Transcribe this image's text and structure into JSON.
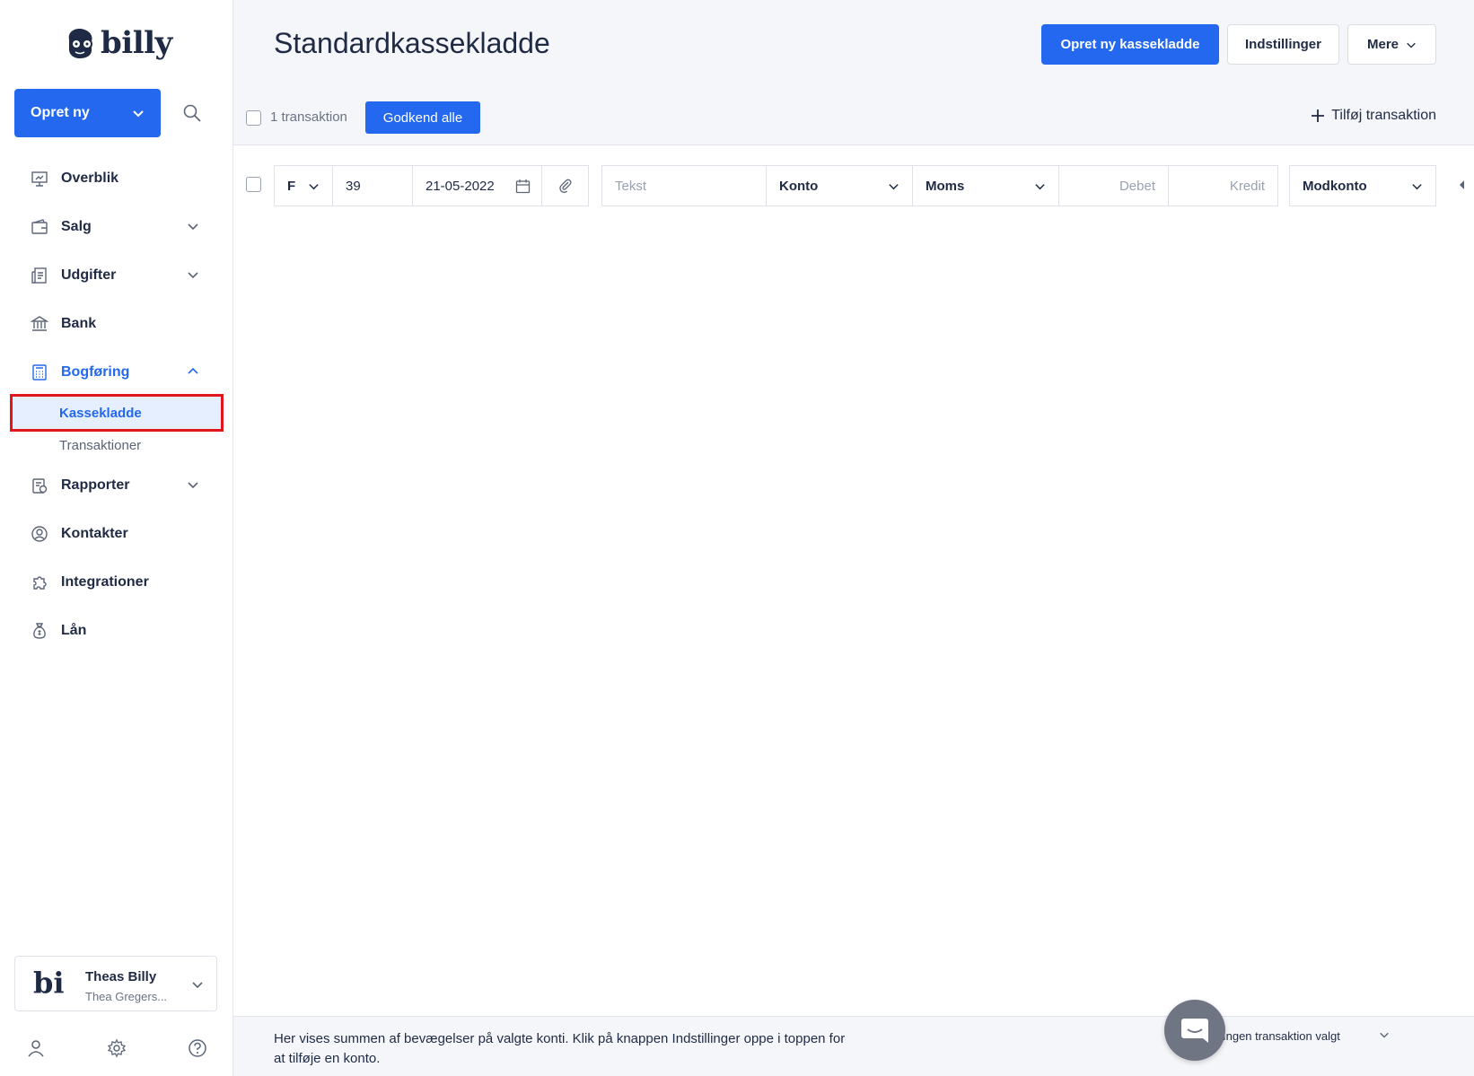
{
  "brand": {
    "name": "billy"
  },
  "sidebar": {
    "create_button": "Opret ny",
    "items": [
      {
        "label": "Overblik",
        "icon": "presentation-icon",
        "chevron": false
      },
      {
        "label": "Salg",
        "icon": "wallet-icon",
        "chevron": true
      },
      {
        "label": "Udgifter",
        "icon": "receipt-icon",
        "chevron": true
      },
      {
        "label": "Bank",
        "icon": "bank-icon",
        "chevron": false
      },
      {
        "label": "Bogføring",
        "icon": "calculator-icon",
        "chevron": true,
        "expanded": true
      },
      {
        "label": "Rapporter",
        "icon": "report-icon",
        "chevron": true
      },
      {
        "label": "Kontakter",
        "icon": "contact-icon",
        "chevron": false
      },
      {
        "label": "Integrationer",
        "icon": "puzzle-icon",
        "chevron": false
      },
      {
        "label": "Lån",
        "icon": "moneybag-icon",
        "chevron": false
      }
    ],
    "sub_items": [
      {
        "label": "Kassekladde",
        "selected": true
      },
      {
        "label": "Transaktioner",
        "selected": false
      }
    ],
    "org": {
      "logo_text": "billy",
      "name": "Theas Billy",
      "subtitle": "Thea Gregers..."
    }
  },
  "header": {
    "title": "Standardkassekladde",
    "primary_button": "Opret ny kassekladde",
    "settings_button": "Indstillinger",
    "more_button": "Mere"
  },
  "toolbar": {
    "transaction_count": "1 transaktion",
    "approve_all": "Godkend alle",
    "add_transaction": "Tilføj transaktion"
  },
  "row": {
    "type": "F",
    "number": "39",
    "date": "21-05-2022",
    "text_placeholder": "Tekst",
    "account": "Konto",
    "vat": "Moms",
    "debit_placeholder": "Debet",
    "credit_placeholder": "Kredit",
    "counter_account": "Modkonto"
  },
  "footer": {
    "text": "Her vises summen af bevægelser på valgte konti. Klik på knappen Indstillinger oppe i toppen for at tilføje en konto.",
    "status": "Ingen transaktion valgt"
  },
  "colors": {
    "accent": "#2368ee",
    "highlight_border": "#e0161b",
    "selected_bg": "#e6efff"
  }
}
